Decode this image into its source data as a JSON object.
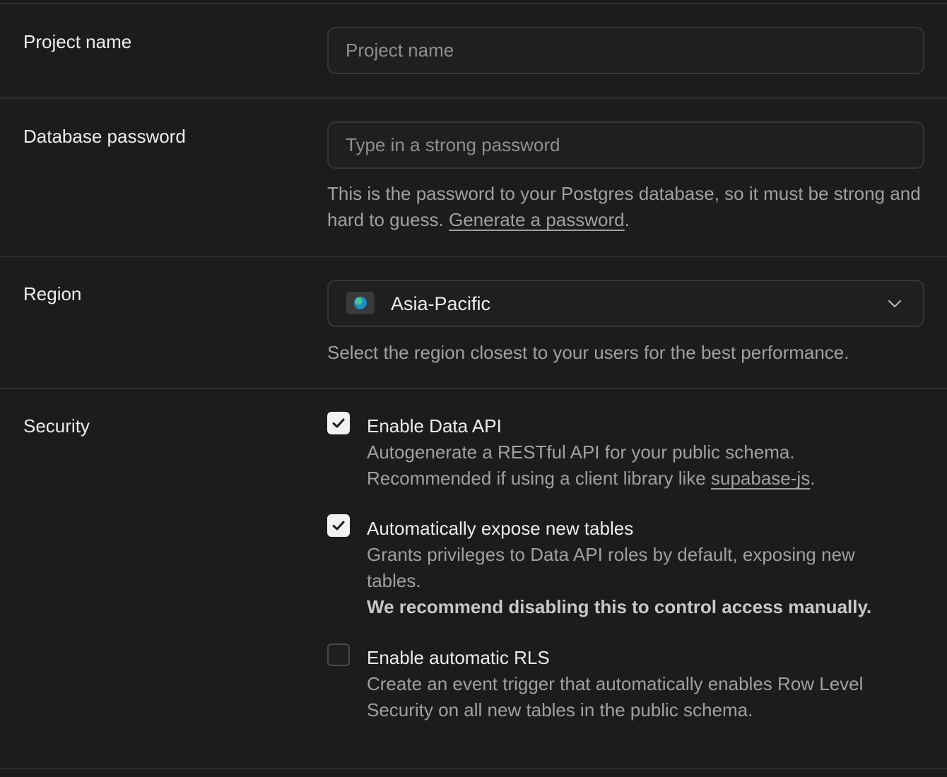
{
  "project": {
    "label": "Project name",
    "placeholder": "Project name"
  },
  "password": {
    "label": "Database password",
    "placeholder": "Type in a strong password",
    "help_text": "This is the password to your Postgres database, so it must be strong and hard to guess. ",
    "help_link": "Generate a password",
    "help_end": "."
  },
  "region": {
    "label": "Region",
    "selected": "Asia-Pacific",
    "help_text": "Select the region closest to your users for the best performance."
  },
  "security": {
    "label": "Security",
    "options": [
      {
        "title": "Enable Data API",
        "checked": true,
        "desc_line1": "Autogenerate a RESTful API for your public schema.",
        "desc_line2": "Recommended if using a client library like ",
        "desc_link": "supabase-js",
        "desc_end": "."
      },
      {
        "title": "Automatically expose new tables",
        "checked": true,
        "desc": "Grants privileges to Data API roles by default, exposing new tables.",
        "desc_strong": "We recommend disabling this to control access manually."
      },
      {
        "title": "Enable automatic RLS",
        "checked": false,
        "desc": "Create an event trigger that automatically enables Row Level Security on all new tables in the public schema."
      }
    ]
  },
  "colors": {
    "background": "#1c1c1c",
    "border": "#2e2e2e",
    "text_primary": "#ededed",
    "text_muted": "#a0a0a0"
  }
}
